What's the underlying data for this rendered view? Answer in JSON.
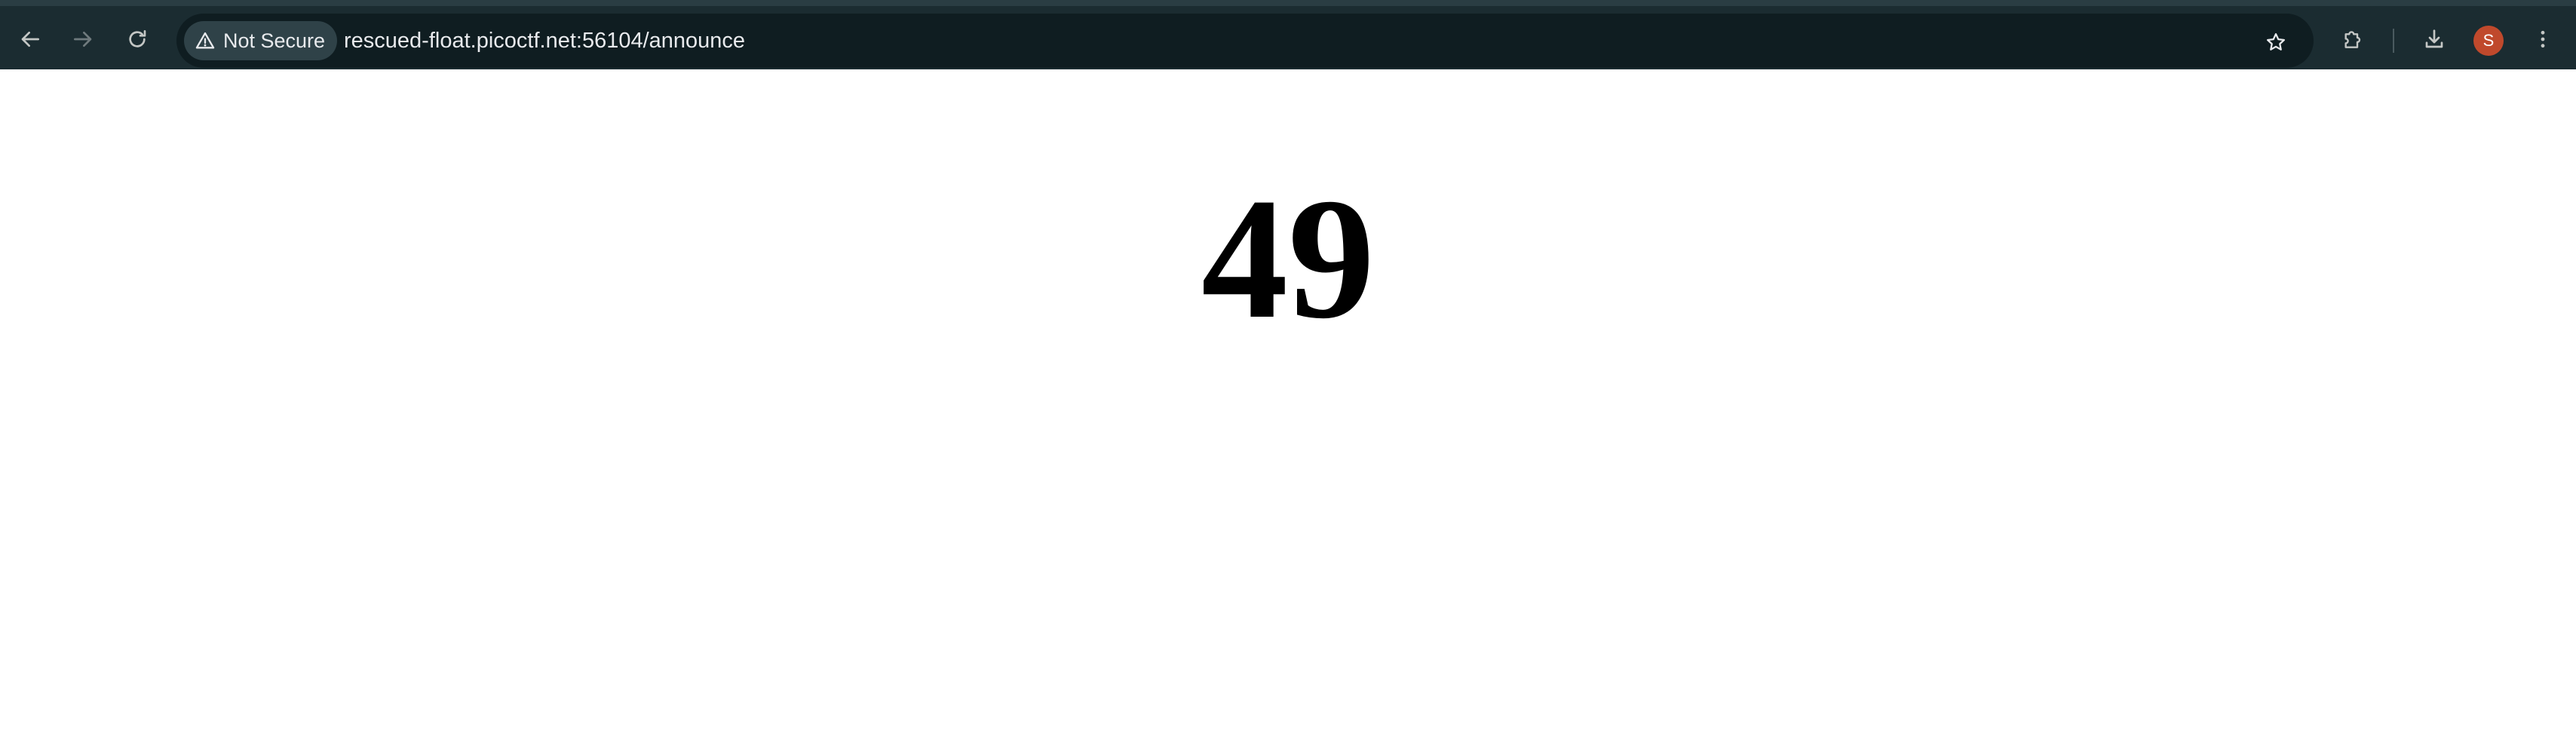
{
  "browser": {
    "security_label": "Not Secure",
    "url": "rescued-float.picoctf.net:56104/announce",
    "profile_initial": "S",
    "icons": {
      "back": "arrow-left-icon",
      "forward": "arrow-right-icon",
      "reload": "reload-icon",
      "security": "warning-triangle-icon",
      "bookmark": "star-icon",
      "extensions": "puzzle-icon",
      "downloads": "download-icon",
      "menu": "kebab-menu-icon"
    },
    "colors": {
      "toolbar": "#1b2c31",
      "omnibox": "#0f1d21",
      "chip": "#2f4248",
      "avatar": "#c0492c"
    }
  },
  "page": {
    "heading": "49",
    "background": "#ffffff"
  }
}
